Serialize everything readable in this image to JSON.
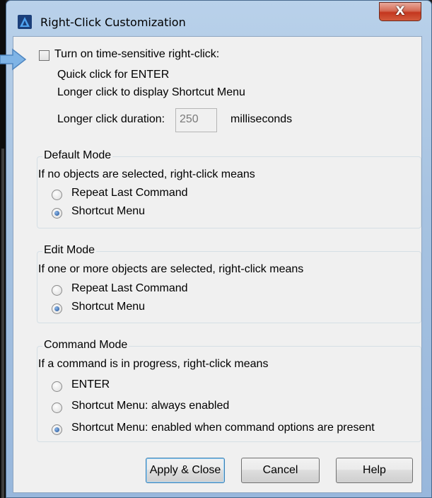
{
  "window": {
    "title": "Right-Click Customization",
    "close_glyph": "X",
    "app_icon": "autocad-triangle-icon"
  },
  "time_sensitive": {
    "checkbox_label": "Turn on time-sensitive right-click:",
    "checked": false,
    "line1": "Quick click for ENTER",
    "line2": "Longer click to display Shortcut Menu",
    "duration_label": "Longer click duration:",
    "duration_value": "250",
    "duration_unit": "milliseconds"
  },
  "default_mode": {
    "title": "Default Mode",
    "desc": "If no objects are selected, right-click means",
    "options": [
      "Repeat Last Command",
      "Shortcut Menu"
    ],
    "selected": 1
  },
  "edit_mode": {
    "title": "Edit Mode",
    "desc": "If one or more objects are selected, right-click means",
    "options": [
      "Repeat Last Command",
      "Shortcut Menu"
    ],
    "selected": 1
  },
  "command_mode": {
    "title": "Command Mode",
    "desc": "If a command is in progress, right-click means",
    "options": [
      "ENTER",
      "Shortcut Menu: always enabled",
      "Shortcut Menu: enabled when command options are present"
    ],
    "selected": 2
  },
  "buttons": {
    "apply": "Apply & Close",
    "cancel": "Cancel",
    "help": "Help"
  },
  "colors": {
    "title_bar": "#a7c3e1",
    "close_button": "#c4371f",
    "radio_dot": "#1c4f96",
    "arrow": "#6fa8dc"
  }
}
